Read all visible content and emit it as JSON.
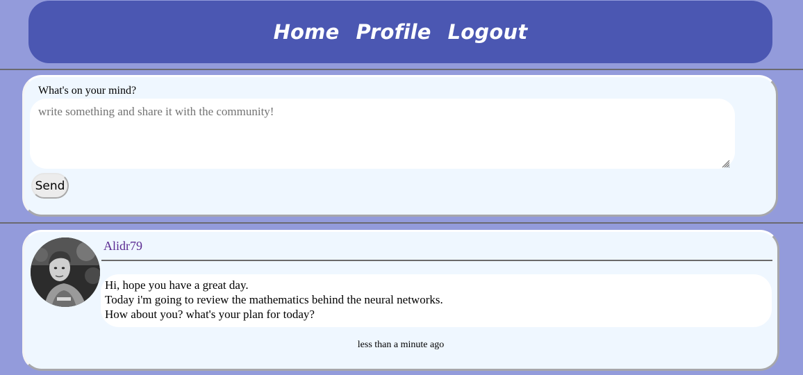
{
  "nav": {
    "items": [
      {
        "label": "Home"
      },
      {
        "label": "Profile"
      },
      {
        "label": "Logout"
      }
    ]
  },
  "compose": {
    "label": "What's on your mind?",
    "placeholder": "write something and share it with the community!",
    "value": "",
    "send_label": "Send"
  },
  "post": {
    "author": "Alidr79",
    "lines": [
      "Hi, hope you have a great day.",
      "Today i'm going to review the mathematics behind the neural networks.",
      "How about you? what's your plan for today?"
    ],
    "timestamp": "less than a minute ago"
  },
  "colors": {
    "page_background": "#939bdb",
    "navbar": "#4b57b2",
    "card": "#eff7ff",
    "author_link": "#5a2a91"
  }
}
